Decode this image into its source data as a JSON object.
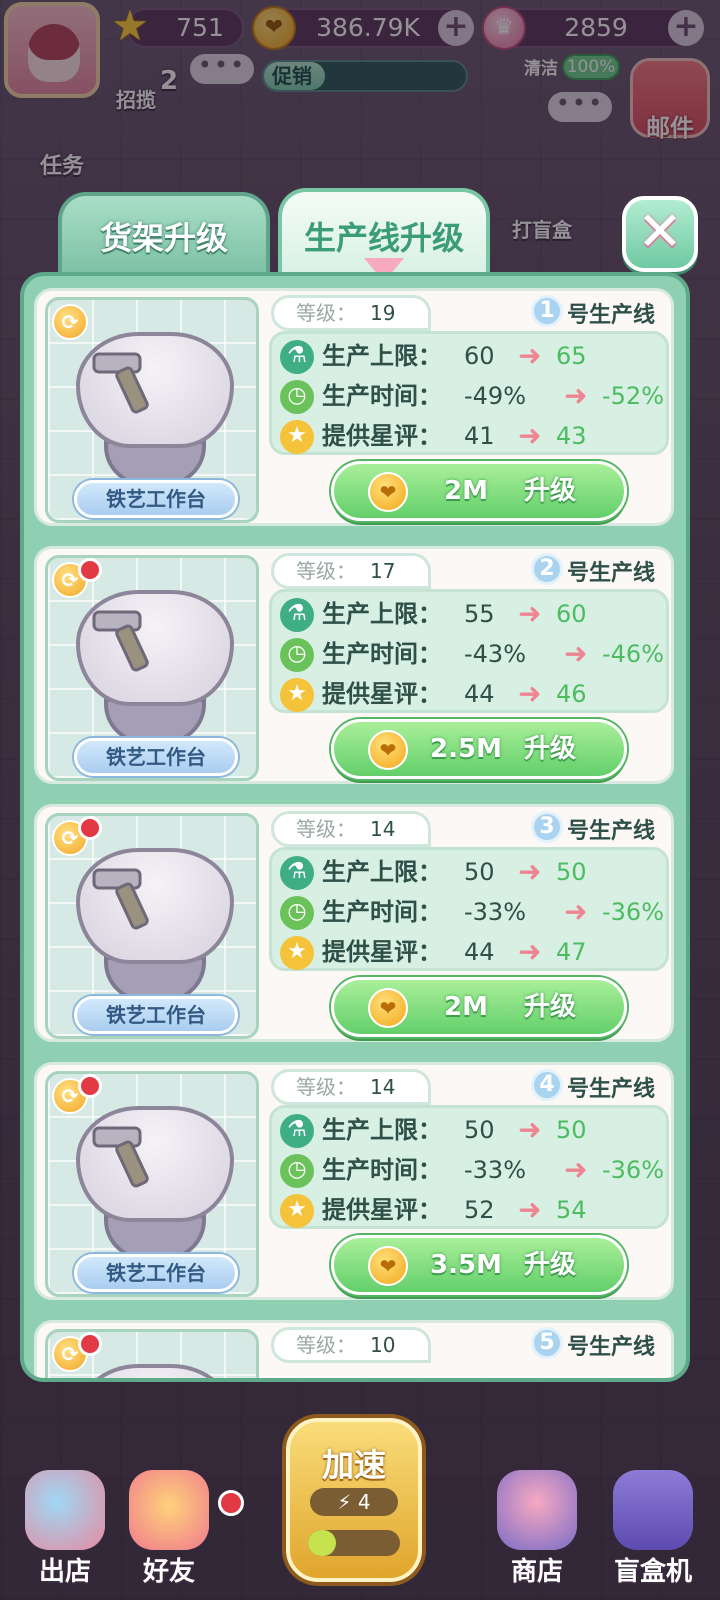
{
  "hud": {
    "stars": "751",
    "coins": "386.79K",
    "gems": "2859",
    "promo_label": "促销",
    "promo_progress": 0.3,
    "recruit_label": "招揽",
    "recruit_count": "2",
    "clean_label": "清洁",
    "clean_value": "100%",
    "mail_label": "邮件",
    "task_label": "任务",
    "blindbox_label": "打盲盒"
  },
  "tabs": [
    {
      "label": "货架升级",
      "active": false
    },
    {
      "label": "生产线升级",
      "active": true
    }
  ],
  "stat_labels": {
    "capacity": "生产上限：",
    "time": "生产时间：",
    "rating": "提供星评："
  },
  "level_label": "等级：",
  "line_suffix": "号生产线",
  "station_name": "铁艺工作台",
  "upgrade_label": "升级",
  "lines": [
    {
      "no": "1",
      "level": "19",
      "cap_from": "60",
      "cap_to": "65",
      "time_from": "-49%",
      "time_to": "-52%",
      "rating_from": "41",
      "rating_to": "43",
      "cost": "2M",
      "has_dot": false
    },
    {
      "no": "2",
      "level": "17",
      "cap_from": "55",
      "cap_to": "60",
      "time_from": "-43%",
      "time_to": "-46%",
      "rating_from": "44",
      "rating_to": "46",
      "cost": "2.5M",
      "has_dot": true
    },
    {
      "no": "3",
      "level": "14",
      "cap_from": "50",
      "cap_to": "50",
      "time_from": "-33%",
      "time_to": "-36%",
      "rating_from": "44",
      "rating_to": "47",
      "cost": "2M",
      "has_dot": true
    },
    {
      "no": "4",
      "level": "14",
      "cap_from": "50",
      "cap_to": "50",
      "time_from": "-33%",
      "time_to": "-36%",
      "rating_from": "52",
      "rating_to": "54",
      "cost": "3.5M",
      "has_dot": true
    },
    {
      "no": "5",
      "level": "10",
      "has_dot": true
    }
  ],
  "bottom": {
    "leave_label": "出店",
    "friends_label": "好友",
    "speed_label": "加速",
    "speed_count": "4",
    "speed_meter": 0.3,
    "shop_label": "商店",
    "blindbox_machine_label": "盲盒机"
  },
  "colors": {
    "panel": "#8fd0b3",
    "upgrade_green": "#63cf6a",
    "arrow_pink": "#ef8493",
    "new_value_green": "#4dbc61"
  }
}
